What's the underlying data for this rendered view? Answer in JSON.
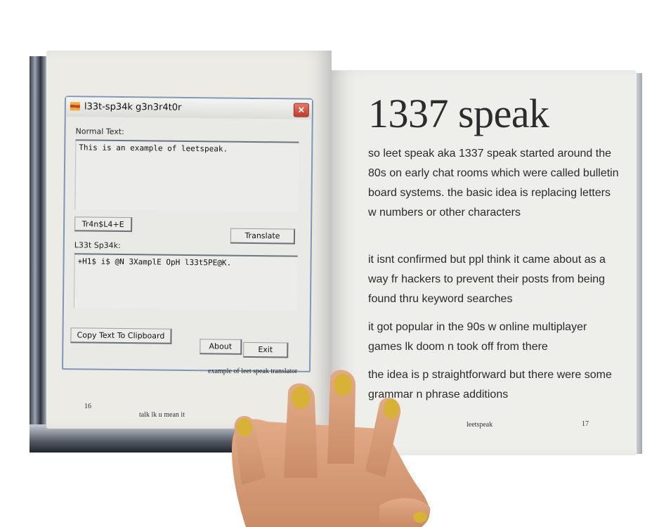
{
  "left_page": {
    "window": {
      "title": "l33t-sp34k g3n3r4t0r",
      "normal_label": "Normal Text:",
      "normal_value": "This is an example of leetspeak.",
      "leet_button": "Tr4n$L4+E",
      "translate_button": "Translate",
      "leet_label": "L33t Sp34k:",
      "leet_value": "+H1$ i$ @N 3XamplE OpH l33t5PE@K.",
      "copy_button": "Copy Text To Clipboard",
      "about_button": "About",
      "exit_button": "Exit",
      "icons": [
        "app-icon",
        "close-icon"
      ]
    },
    "caption": "example of leet speak translator",
    "page_number": "16",
    "running_footer": "talk lk u mean it"
  },
  "right_page": {
    "heading": "1337 speak",
    "paragraphs": [
      "so leet speak aka 1337 speak started around the 80s on early chat rooms which were called bulletin board systems. the basic idea is replacing letters w numbers or other characters",
      "it isnt confirmed but ppl think it came about as a way fr hackers to prevent their posts from being found thru keyword searches",
      "it got popular in the 90s w online multiplayer games lk doom n took off from there",
      "the idea is p straightforward but there were some grammar n phrase additions"
    ],
    "running_footer": "leetspeak",
    "page_number": "17"
  },
  "colors": {
    "page": "#eeeeea",
    "window_border": "#7d97b8",
    "close_button": "#c0392b",
    "nail_polish": "#d8b236",
    "skin": "#d9a07c"
  }
}
